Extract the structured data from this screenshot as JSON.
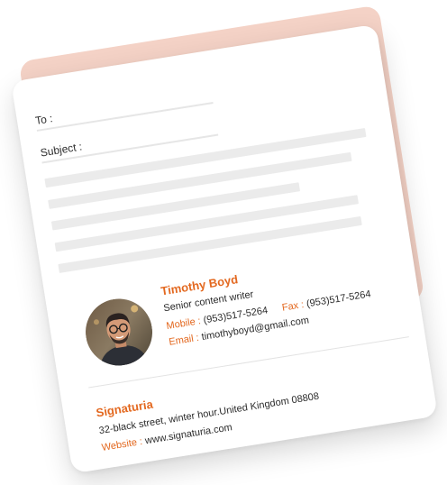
{
  "email": {
    "to_label": "To :",
    "subject_label": "Subject :"
  },
  "signature": {
    "name": "Timothy Boyd",
    "title": "Senior content writer",
    "mobile_label": "Mobile :",
    "mobile_value": "(953)517-5264",
    "fax_label": "Fax :",
    "fax_value": "(953)517-5264",
    "email_label": "Email :",
    "email_value": "timothyboyd@gmail.com",
    "company": "Signaturia",
    "address": "32-black street, winter hour.United Kingdom 08808",
    "website_label": "Website :",
    "website_value": "www.signaturia.com"
  },
  "colors": {
    "accent": "#e3681f",
    "back_card": "#f4d2c6",
    "placeholder": "#ebebeb"
  }
}
